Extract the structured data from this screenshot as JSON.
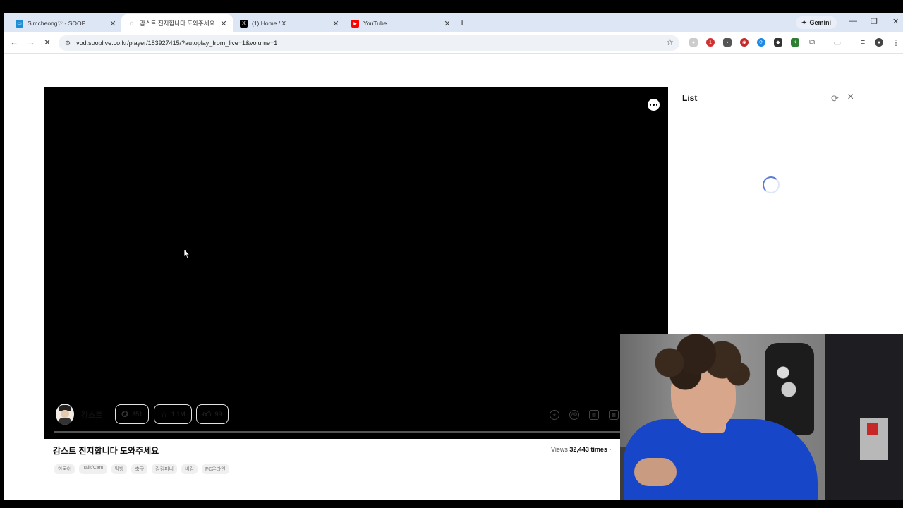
{
  "browser": {
    "tabs": [
      {
        "title": "Simcheong♡ - SOOP",
        "favicon": "soop-icon",
        "color": "#1a8fd8"
      },
      {
        "title": "감스트 진지합니다 도와주세요",
        "favicon": "loading-icon",
        "color": "#555555",
        "active": true
      },
      {
        "title": "(1) Home / X",
        "favicon": "x-icon",
        "color": "#000000"
      },
      {
        "title": "YouTube",
        "favicon": "youtube-icon",
        "color": "#ff0000"
      }
    ],
    "new_tab": "+",
    "gemini_label": "Gemini",
    "url": "vod.sooplive.co.kr/player/183927415/?autoplay_from_live=1&volume=1"
  },
  "page": {
    "side_panel": {
      "title": "List"
    },
    "stats": {
      "subscribers": "351",
      "favorites": "1.1M",
      "likes": "99"
    },
    "streamer_name": "감스트",
    "video_title": "감스트 진지합니다 도와주세요",
    "views_label": "Views",
    "views_count": "32,443 times",
    "tags": [
      "한국어",
      "Talk/Cam",
      "먹방",
      "축구",
      "감컴퍼니",
      "버컴",
      "FC온라인"
    ],
    "progress_fraction": 0.0
  }
}
